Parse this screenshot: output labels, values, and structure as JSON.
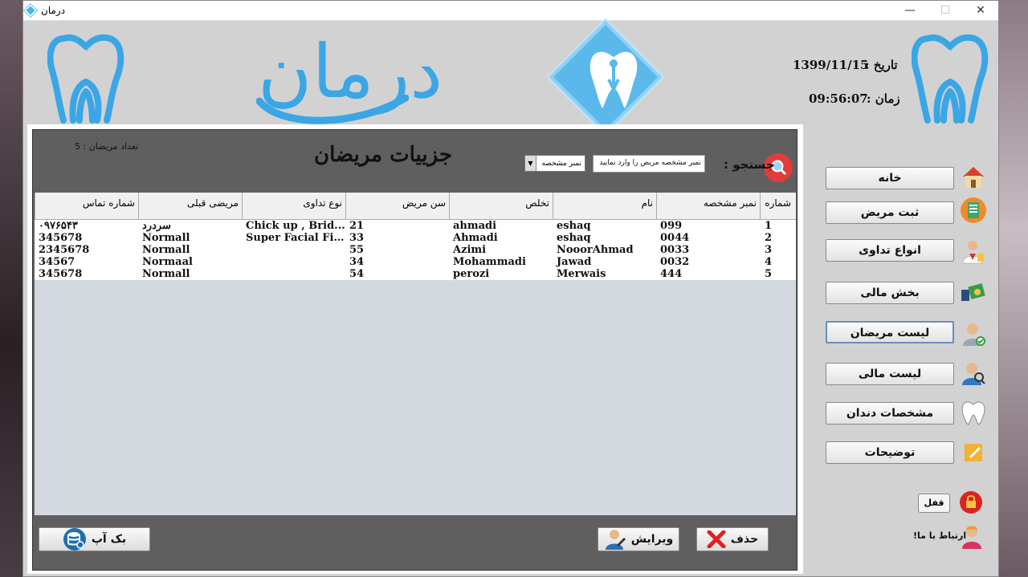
{
  "window": {
    "title": "درمان",
    "controls": {
      "minimize": "—",
      "maximize": "☐",
      "close": "✕"
    }
  },
  "header": {
    "logo_text": "درمان",
    "date_label": "تاریخ :",
    "date_value": "1399/11/15",
    "time_label": "زمان :",
    "time_value": "09:56:07"
  },
  "panel": {
    "title": "جزییات مریضان",
    "count_label": "تعداد مریضان :",
    "count_value": "5",
    "search_label": "جستجو :",
    "search_placeholder": "نمبر مشخصه مریض را وارد نمایید",
    "filter_selected": "نمبر مشخصه"
  },
  "table": {
    "columns": [
      "شماره تماس",
      "مریضی قبلی",
      "نوع تداوی",
      "سن مریض",
      "تخلص",
      "نام",
      "نمبر مشخصه",
      "شماره"
    ],
    "rows": [
      [
        "۰۹۷۶۵۴۳",
        "سردرد",
        "Chick up , Brid...",
        "21",
        "ahmadi",
        "eshaq",
        "099",
        "1"
      ],
      [
        "345678",
        "Normall",
        "Super Facial Fill...",
        "33",
        "Ahmadi",
        "eshaq",
        "0044",
        "2"
      ],
      [
        "2345678",
        "Normall",
        "",
        "55",
        "Azimi",
        "NooorAhmad",
        "0033",
        "3"
      ],
      [
        "34567",
        "Normaal",
        "",
        "34",
        "Mohammadi",
        "Jawad",
        "0032",
        "4"
      ],
      [
        "345678",
        "Normall",
        "",
        "54",
        "perozi",
        "Merwais",
        "444",
        "5"
      ]
    ]
  },
  "actions": {
    "backup": "بک آپ",
    "edit": "ویرایش",
    "delete": "حذف"
  },
  "sidebar": {
    "items": [
      {
        "label": "خانه",
        "icon": "home-icon"
      },
      {
        "label": "ثبت مریض",
        "icon": "register-icon"
      },
      {
        "label": "انواع تداوی",
        "icon": "treatment-icon"
      },
      {
        "label": "بخش مالی",
        "icon": "finance-icon"
      },
      {
        "label": "لیست مریضان",
        "icon": "patient-list-icon"
      },
      {
        "label": "لیست مالی",
        "icon": "financial-list-icon"
      },
      {
        "label": "مشخصات دندان",
        "icon": "tooth-icon"
      },
      {
        "label": "توضیحات",
        "icon": "notes-icon"
      }
    ],
    "lock": "قفل",
    "contact": "ارتباط با ما!"
  },
  "colors": {
    "accent": "#3aa6e6",
    "panel": "#5f5f5f",
    "danger": "#e23b3b"
  }
}
